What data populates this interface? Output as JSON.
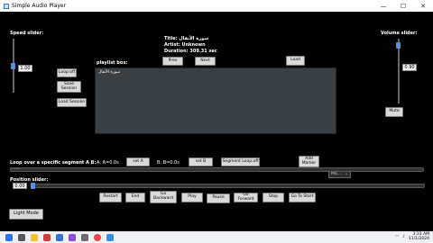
{
  "window": {
    "title": "Simple Audio Player",
    "minimize": "—",
    "maximize": "☐",
    "close": "✕"
  },
  "speed": {
    "label": "Speed slider:",
    "value": "1.00",
    "level": 0.5
  },
  "volume": {
    "label": "Volume slider:",
    "value": "0.90",
    "level": 0.9
  },
  "buttons": {
    "loop_off": "Loop:off",
    "save_session": "Save Session",
    "load_session": "Load Session",
    "prev": "Prev",
    "next": "Next",
    "load": "Load",
    "mute": "Mute",
    "set_a": "set A",
    "set_b": "set B",
    "segment_loop": "Segment Loop:off",
    "add_marker": "Add Marker",
    "restart": "Restart",
    "end": "End",
    "go_backward": "Go Backward",
    "play": "Play",
    "pause": "Pause",
    "go_forward": "Go Forward",
    "stop": "Stop",
    "go_to_start": "Go To Start",
    "light_mode": "Light Mode"
  },
  "track_info": {
    "title": "Title: سورة الأنفال",
    "artist": "Artist: Unknown",
    "duration": "Duration: 309.31 sec"
  },
  "playlist": {
    "label": "playlist box:",
    "items": [
      "سورة الأنفال"
    ]
  },
  "loop_segment": {
    "label": "Loop over a specific segment A B:",
    "a_value": "A: A=0.0s",
    "b_value": "B: B=0.0s",
    "sub": "A: 0.0s"
  },
  "marker_combo": {
    "value": "Ma..."
  },
  "position": {
    "label": "Position slider:",
    "value": "0.00",
    "level": 0.0
  },
  "taskbar": {
    "time": "3:33 AM",
    "date": "11/1/2024"
  }
}
